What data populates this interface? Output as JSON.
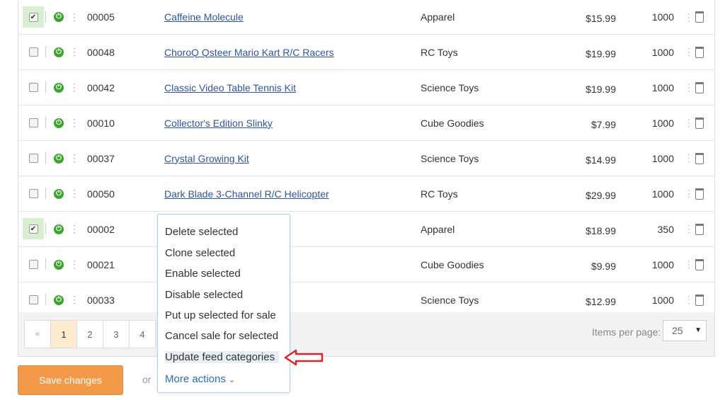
{
  "rows": [
    {
      "selected": true,
      "code": "00005",
      "name": "Caffeine Molecule",
      "category": "Apparel",
      "price": "$15.99",
      "qty": "1000"
    },
    {
      "selected": false,
      "code": "00048",
      "name": "ChoroQ Qsteer Mario Kart R/C Racers",
      "category": "RC Toys",
      "price": "$19.99",
      "qty": "1000"
    },
    {
      "selected": false,
      "code": "00042",
      "name": "Classic Video Table Tennis Kit",
      "category": "Science Toys",
      "price": "$19.99",
      "qty": "1000"
    },
    {
      "selected": false,
      "code": "00010",
      "name": "Collector's Edition Slinky",
      "category": "Cube Goodies",
      "price": "$7.99",
      "qty": "1000"
    },
    {
      "selected": false,
      "code": "00037",
      "name": "Crystal Growing Kit",
      "category": "Science Toys",
      "price": "$14.99",
      "qty": "1000"
    },
    {
      "selected": false,
      "code": "00050",
      "name": "Dark Blade 3-Channel R/C Helicopter",
      "category": "RC Toys",
      "price": "$29.99",
      "qty": "1000"
    },
    {
      "selected": true,
      "code": "00002",
      "name": "",
      "category": "Apparel",
      "price": "$18.99",
      "qty": "350"
    },
    {
      "selected": false,
      "code": "00021",
      "name": "",
      "category": "Cube Goodies",
      "price": "$9.99",
      "qty": "1000"
    },
    {
      "selected": false,
      "code": "00033",
      "name": "",
      "category": "Science Toys",
      "price": "$12.99",
      "qty": "1000"
    }
  ],
  "pagination": {
    "prev": "«",
    "pages": [
      "1",
      "2",
      "3",
      "4"
    ],
    "active": "1"
  },
  "items_per_page": {
    "label": "Items per page:",
    "value": "25"
  },
  "save_label": "Save changes",
  "or_label": "or",
  "menu": {
    "items": [
      "Delete selected",
      "Clone selected",
      "Enable selected",
      "Disable selected",
      "Put up selected for sale",
      "Cancel sale for selected",
      "Update feed categories"
    ],
    "highlighted": "Update feed categories",
    "more_actions": "More actions"
  },
  "colors": {
    "accent": "#f39a4a",
    "link": "#2d55a0",
    "power": "#3aa52b",
    "callout": "#d9262b",
    "menu_border": "#a8d4ea"
  },
  "icons": {
    "power": "power-icon",
    "kebab": "kebab-menu-icon",
    "trash": "trash-icon",
    "chevron": "chevron-down-icon",
    "callout": "red-arrow-icon"
  }
}
